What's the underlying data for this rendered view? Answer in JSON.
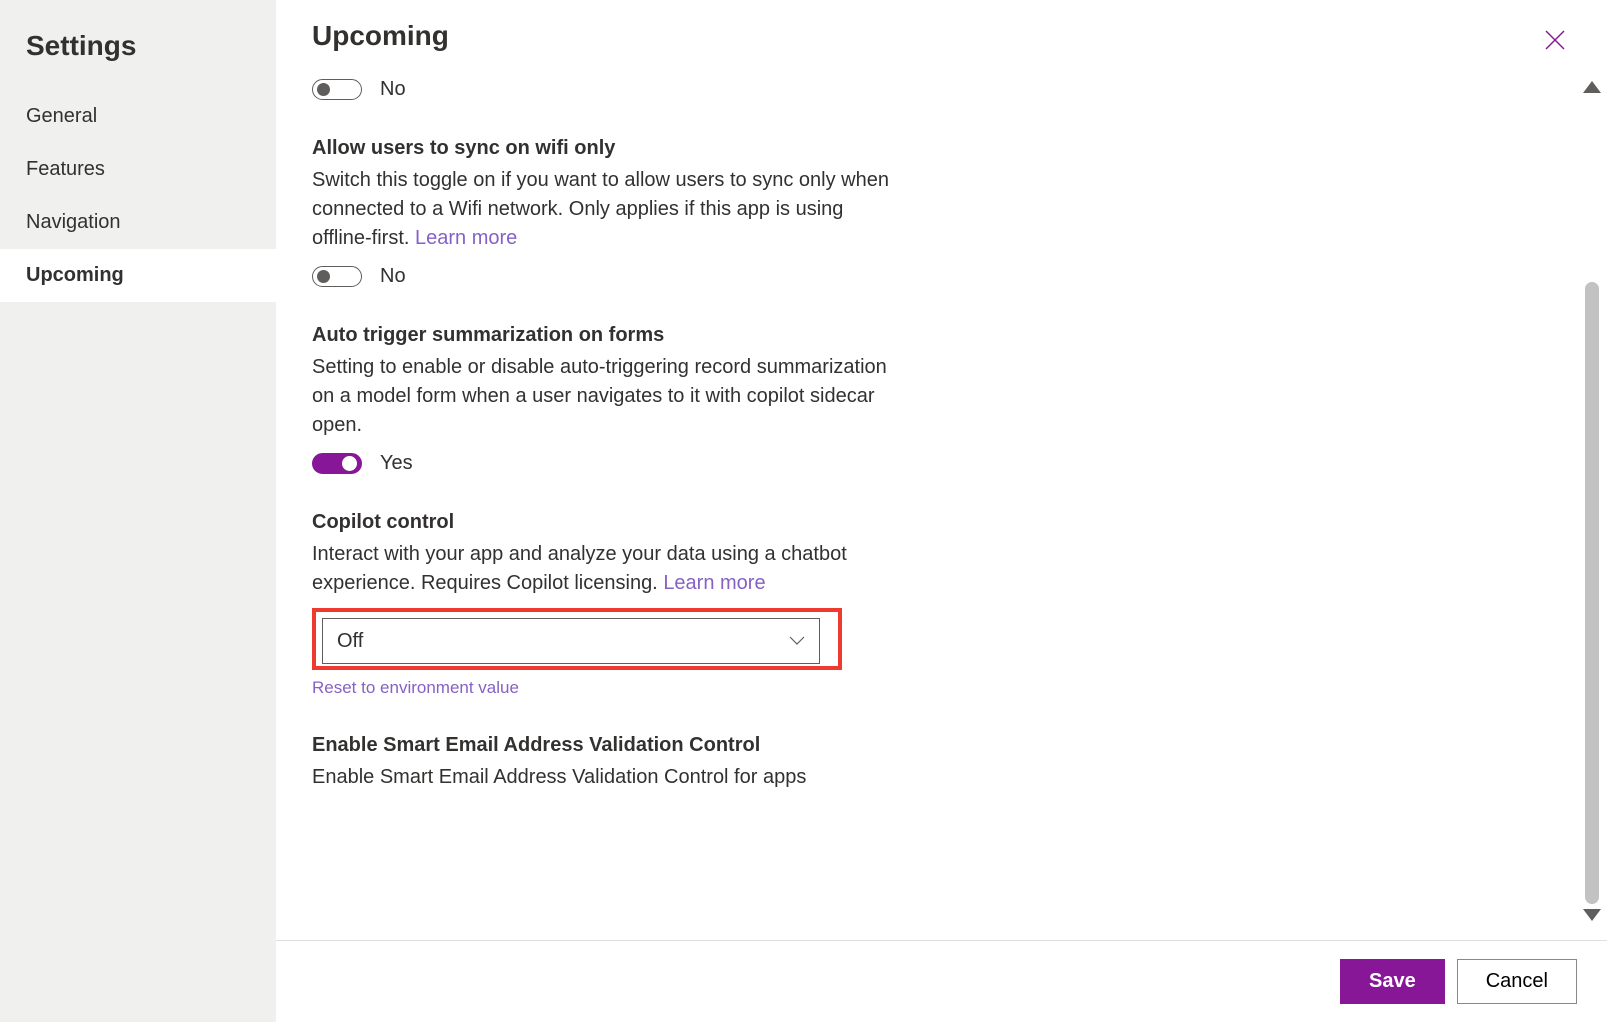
{
  "sidebar": {
    "title": "Settings",
    "items": [
      {
        "label": "General",
        "active": false
      },
      {
        "label": "Features",
        "active": false
      },
      {
        "label": "Navigation",
        "active": false
      },
      {
        "label": "Upcoming",
        "active": true
      }
    ]
  },
  "header": {
    "title": "Upcoming"
  },
  "sections": {
    "top_toggle": {
      "value_label": "No",
      "on": false
    },
    "wifi": {
      "title": "Allow users to sync on wifi only",
      "desc": "Switch this toggle on if you want to allow users to sync only when connected to a Wifi network. Only applies if this app is using offline-first. ",
      "learn_more": "Learn more",
      "value_label": "No",
      "on": false
    },
    "summarization": {
      "title": "Auto trigger summarization on forms",
      "desc": "Setting to enable or disable auto-triggering record summarization on a model form when a user navigates to it with copilot sidecar open.",
      "value_label": "Yes",
      "on": true
    },
    "copilot": {
      "title": "Copilot control",
      "desc": "Interact with your app and analyze your data using a chatbot experience. Requires Copilot licensing. ",
      "learn_more": "Learn more",
      "selected": "Off",
      "reset_label": "Reset to environment value"
    },
    "email_validation": {
      "title": "Enable Smart Email Address Validation Control",
      "desc": "Enable Smart Email Address Validation Control for apps"
    }
  },
  "footer": {
    "save": "Save",
    "cancel": "Cancel"
  },
  "colors": {
    "accent": "#881798",
    "link": "#8661c5",
    "highlight_box": "#ef3a2f"
  }
}
